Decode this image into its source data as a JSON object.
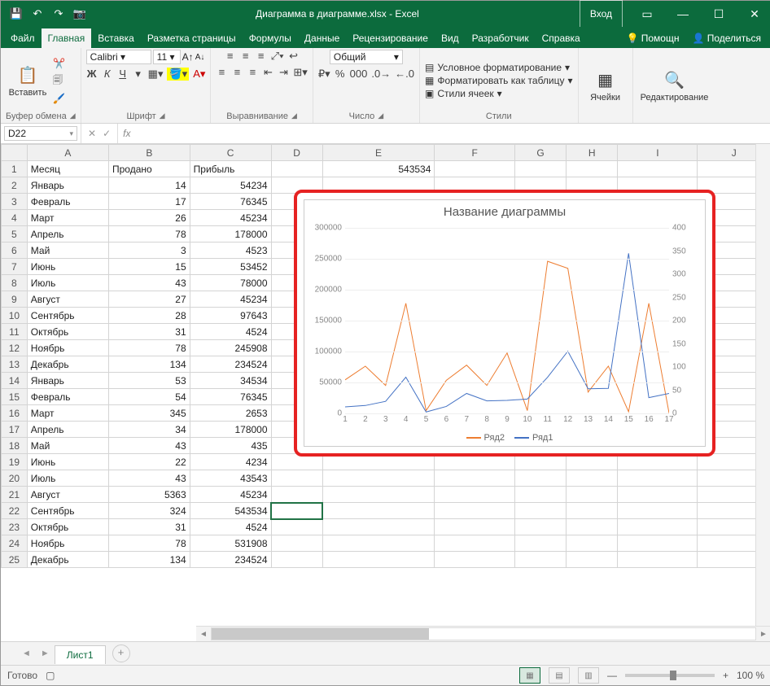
{
  "titlebar": {
    "title": "Диаграмма в диаграмме.xlsx  -  Excel",
    "login": "Вход"
  },
  "tabs": {
    "items": [
      "Файл",
      "Главная",
      "Вставка",
      "Разметка страницы",
      "Формулы",
      "Данные",
      "Рецензирование",
      "Вид",
      "Разработчик",
      "Справка"
    ],
    "active": 1,
    "right": {
      "help": "Помощн",
      "share": "Поделиться"
    }
  },
  "ribbon": {
    "clipboard": {
      "paste": "Вставить",
      "label": "Буфер обмена"
    },
    "font": {
      "name": "Calibri",
      "size": "11",
      "label": "Шрифт",
      "bold": "Ж",
      "italic": "К",
      "underline": "Ч"
    },
    "align": {
      "label": "Выравнивание"
    },
    "number": {
      "format": "Общий",
      "label": "Число"
    },
    "styles": {
      "cond": "Условное форматирование",
      "table": "Форматировать как таблицу",
      "cell": "Стили ячеек",
      "label": "Стили"
    },
    "cells": {
      "label": "Ячейки"
    },
    "editing": {
      "label": "Редактирование"
    }
  },
  "formula_bar": {
    "name_box": "D22",
    "value": ""
  },
  "columns": [
    "A",
    "B",
    "C",
    "D",
    "E",
    "F",
    "G",
    "H",
    "I",
    "J"
  ],
  "extra_cell": {
    "addr": "E1",
    "value": "543534"
  },
  "table": {
    "headers": [
      "Месяц",
      "Продано",
      "Прибыль"
    ],
    "rows": [
      [
        "Январь",
        "14",
        "54234"
      ],
      [
        "Февраль",
        "17",
        "76345"
      ],
      [
        "Март",
        "26",
        "45234"
      ],
      [
        "Апрель",
        "78",
        "178000"
      ],
      [
        "Май",
        "3",
        "4523"
      ],
      [
        "Июнь",
        "15",
        "53452"
      ],
      [
        "Июль",
        "43",
        "78000"
      ],
      [
        "Август",
        "27",
        "45234"
      ],
      [
        "Сентябрь",
        "28",
        "97643"
      ],
      [
        "Октябрь",
        "31",
        "4524"
      ],
      [
        "Ноябрь",
        "78",
        "245908"
      ],
      [
        "Декабрь",
        "134",
        "234524"
      ],
      [
        "Январь",
        "53",
        "34534"
      ],
      [
        "Февраль",
        "54",
        "76345"
      ],
      [
        "Март",
        "345",
        "2653"
      ],
      [
        "Апрель",
        "34",
        "178000"
      ],
      [
        "Май",
        "43",
        "435"
      ],
      [
        "Июнь",
        "22",
        "4234"
      ],
      [
        "Июль",
        "43",
        "43543"
      ],
      [
        "Август",
        "5363",
        "45234"
      ],
      [
        "Сентябрь",
        "324",
        "543534"
      ],
      [
        "Октябрь",
        "31",
        "4524"
      ],
      [
        "Ноябрь",
        "78",
        "531908"
      ],
      [
        "Декабрь",
        "134",
        "234524"
      ]
    ]
  },
  "chart_data": {
    "type": "line",
    "title": "Название диаграммы",
    "x": [
      1,
      2,
      3,
      4,
      5,
      6,
      7,
      8,
      9,
      10,
      11,
      12,
      13,
      14,
      15,
      16,
      17
    ],
    "y1": {
      "label": "",
      "min": 0,
      "max": 300000,
      "step": 50000
    },
    "y2": {
      "label": "",
      "min": 0,
      "max": 400,
      "step": 50
    },
    "series": [
      {
        "name": "Ряд2",
        "axis": "y1",
        "color": "#ed7d31",
        "values": [
          54234,
          76345,
          45234,
          178000,
          4523,
          53452,
          78000,
          45234,
          97643,
          4524,
          245908,
          234524,
          34534,
          76345,
          2653,
          178000,
          435
        ]
      },
      {
        "name": "Ряд1",
        "axis": "y2",
        "color": "#4472c4",
        "values": [
          14,
          17,
          26,
          78,
          3,
          15,
          43,
          27,
          28,
          31,
          78,
          134,
          53,
          54,
          345,
          34,
          43
        ]
      }
    ]
  },
  "sheet_tabs": {
    "active": "Лист1"
  },
  "status": {
    "ready": "Готово",
    "zoom": "100 %"
  }
}
